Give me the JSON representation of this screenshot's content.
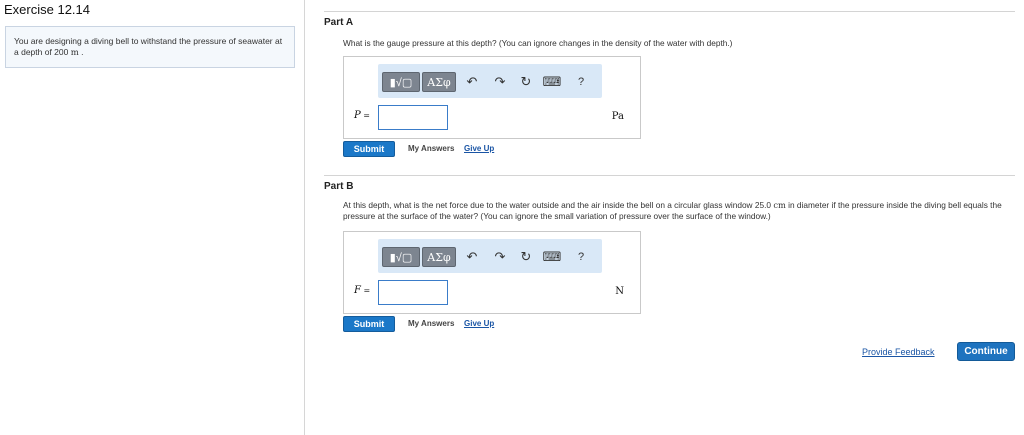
{
  "exercise": {
    "title": "Exercise 12.14",
    "problem_text": "You are designing a diving bell to withstand the pressure of seawater at a depth of 200",
    "problem_unit": "m",
    "problem_end": "."
  },
  "toolbar": {
    "templates_label": "▮√▢",
    "symbols_label": "ΑΣφ",
    "undo_icon": "↶",
    "redo_icon": "↷",
    "reset_icon": "↻",
    "keyboard_icon": "⌨",
    "help_label": "?"
  },
  "part_a": {
    "title": "Part A",
    "question": "What is the gauge pressure at this depth? (You can ignore changes in the density of the water with depth.)",
    "variable": "P",
    "equals": " =",
    "input_value": "",
    "unit": "Pa",
    "submit_label": "Submit",
    "my_answers_label": "My Answers",
    "give_up_label": "Give Up"
  },
  "part_b": {
    "title": "Part B",
    "question_start": "At this depth, what is the net force due to the water outside and the air inside the bell on a circular glass window 25.0",
    "question_unit": "cm",
    "question_end": "in diameter if the pressure inside the diving bell equals the pressure at the surface of the water? (You can ignore the small variation of pressure over the surface of the window.)",
    "variable": "F",
    "equals": " =",
    "input_value": "",
    "unit": "N",
    "submit_label": "Submit",
    "my_answers_label": "My Answers",
    "give_up_label": "Give Up"
  },
  "footer": {
    "feedback_label": "Provide Feedback",
    "continue_label": "Continue"
  }
}
